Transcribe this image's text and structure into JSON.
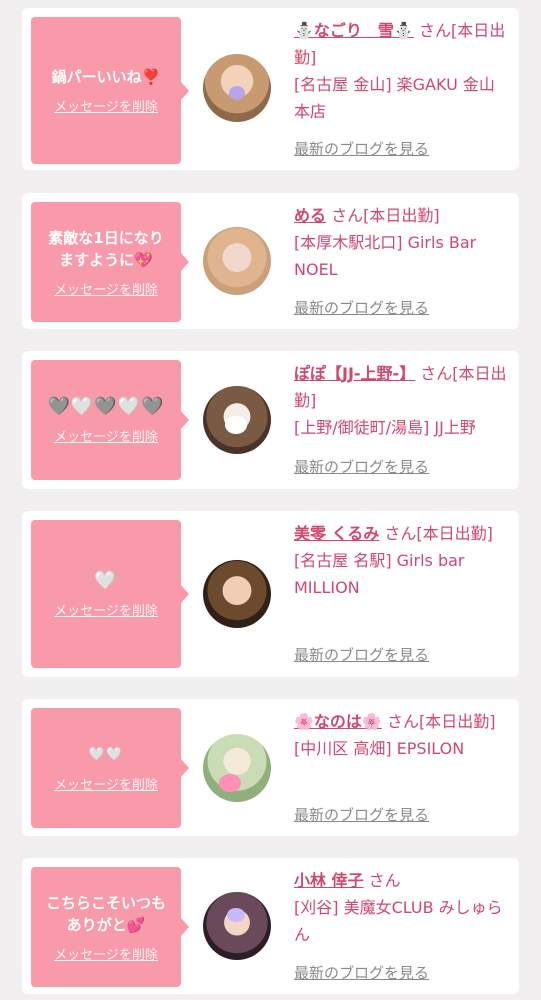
{
  "entries": [
    {
      "message": "鍋パーいいね❣️",
      "delete_label": "メッセージを削除",
      "name": "⛄なごり　雪⛄",
      "suffix": "さん[本日出勤]",
      "shop": "[名古屋 金山] 楽GAKU 金山本店",
      "blog_label": "最新のブログを見る"
    },
    {
      "message": "素敵な1日になり\nますように💖",
      "delete_label": "メッセージを削除",
      "name": "める",
      "suffix": "さん[本日出勤]",
      "shop": "[本厚木駅北口] Girls Bar NOEL",
      "blog_label": "最新のブログを見る"
    },
    {
      "message": "🩶🤍🩶🤍🩶",
      "delete_label": "メッセージを削除",
      "name": "ぽぽ【JJ-上野-】",
      "suffix": "さん[本日出勤]",
      "shop": "[上野/御徒町/湯島] JJ上野",
      "blog_label": "最新のブログを見る"
    },
    {
      "message": "🤍",
      "delete_label": "メッセージを削除",
      "name": "美零 くるみ",
      "suffix": "さん[本日出勤]",
      "shop": "[名古屋 名駅] Girls bar MILLION",
      "blog_label": "最新のブログを見る"
    },
    {
      "message": "🤍🤍",
      "delete_label": "メッセージを削除",
      "name": "🌸なのは🌸",
      "suffix": "さん[本日出勤]",
      "shop": "[中川区 高畑] EPSILON",
      "blog_label": "最新のブログを見る"
    },
    {
      "message": "こちらこそいつも\nありがと💕",
      "delete_label": "メッセージを削除",
      "name": "小林 倖子",
      "suffix": "さん",
      "shop": "[刈谷] 美魔女CLUB みしゅらん",
      "blog_label": "最新のブログを見る"
    }
  ],
  "colors": {
    "bubble": "#f89aaa",
    "accent_text": "#d0486c",
    "link_gray": "#8a8a8a",
    "page_bg": "#f1eff0"
  }
}
